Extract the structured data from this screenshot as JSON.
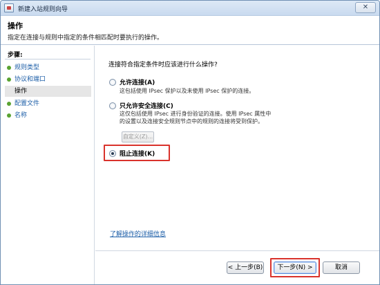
{
  "window": {
    "title": "新建入站规则向导",
    "close_glyph": "✕"
  },
  "header": {
    "title": "操作",
    "description": "指定在连接与规则中指定的条件相匹配时要执行的操作。"
  },
  "sidebar": {
    "steps_label": "步骤:",
    "items": [
      {
        "label": "规则类型",
        "state": "done"
      },
      {
        "label": "协议和端口",
        "state": "done"
      },
      {
        "label": "操作",
        "state": "current"
      },
      {
        "label": "配置文件",
        "state": "todo"
      },
      {
        "label": "名称",
        "state": "todo"
      }
    ]
  },
  "main": {
    "question": "连接符合指定条件时应该进行什么操作?",
    "options": [
      {
        "label": "允许连接(A)",
        "description": "这包括使用 IPsec 保护以及未使用 IPsec 保护的连接。",
        "checked": false
      },
      {
        "label": "只允许安全连接(C)",
        "description": "这仅包括使用 IPsec 进行身份验证的连接。使用 IPsec 属性中的设置以及连接安全规则节点中的规则的连接将受到保护。",
        "checked": false
      },
      {
        "label": "阻止连接(K)",
        "description": "",
        "checked": true
      }
    ],
    "customize_button": "自定义(Z)...",
    "learn_more_link": "了解操作的详细信息"
  },
  "footer": {
    "back_label": "< 上一步(B)",
    "next_label": "下一步(N) >",
    "cancel_label": "取消"
  },
  "colors": {
    "highlight": "#d9322b",
    "link": "#1e5fa8",
    "step_dot": "#5aa331"
  }
}
